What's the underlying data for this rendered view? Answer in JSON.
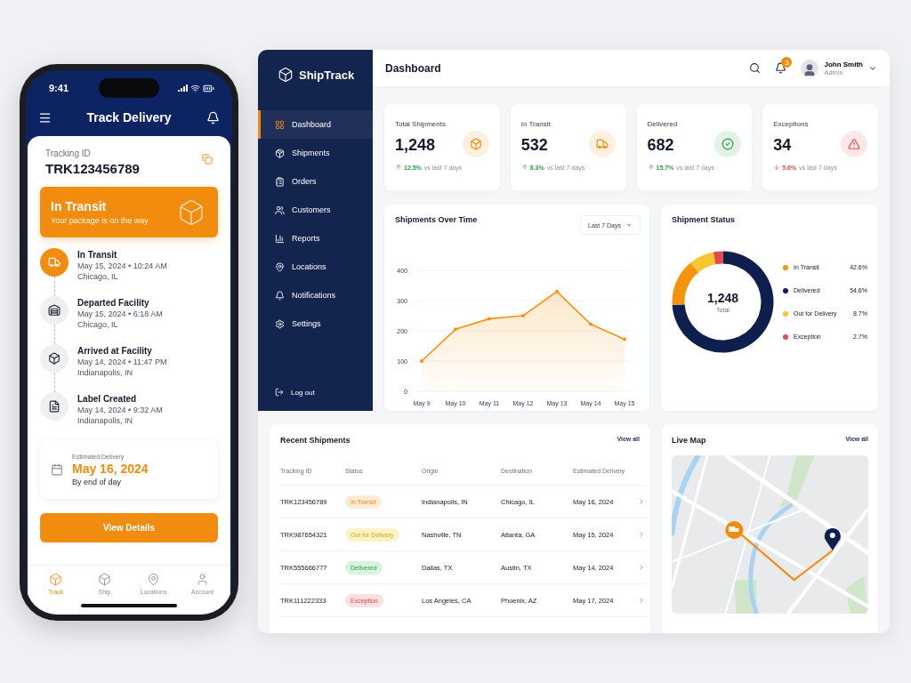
{
  "phone": {
    "status_bar": {
      "time": "9:41"
    },
    "header": {
      "title": "Track Delivery"
    },
    "tracking": {
      "label": "Tracking ID",
      "id": "TRK123456789"
    },
    "banner": {
      "title": "In Transit",
      "subtitle": "Your package is on the way"
    },
    "timeline": [
      {
        "title": "In Transit",
        "time": "May 15, 2024 • 10:24 AM",
        "place": "Chicago, IL",
        "active": true
      },
      {
        "title": "Departed Facility",
        "time": "May 15, 2024 • 6:18 AM",
        "place": "Chicago, IL",
        "active": false
      },
      {
        "title": "Arrived at Facility",
        "time": "May 14, 2024 • 11:47 PM",
        "place": "Indianapolis, IN",
        "active": false
      },
      {
        "title": "Label Created",
        "time": "May 14, 2024 • 9:32 AM",
        "place": "Indianapolis, IN",
        "active": false
      }
    ],
    "estimate": {
      "label": "Estimated Delivery",
      "date": "May 16, 2024",
      "note": "By end of day"
    },
    "button": "View Details",
    "nav": [
      {
        "label": "Track",
        "selected": true
      },
      {
        "label": "Ship",
        "selected": false
      },
      {
        "label": "Locations",
        "selected": false
      },
      {
        "label": "Account",
        "selected": false
      }
    ]
  },
  "dashboard": {
    "brand": "ShipTrack",
    "sidebar": {
      "items": [
        {
          "label": "Dashboard",
          "selected": true
        },
        {
          "label": "Shipments",
          "selected": false
        },
        {
          "label": "Orders",
          "selected": false
        },
        {
          "label": "Customers",
          "selected": false
        },
        {
          "label": "Reports",
          "selected": false
        },
        {
          "label": "Locations",
          "selected": false
        },
        {
          "label": "Notifications",
          "selected": false
        },
        {
          "label": "Settings",
          "selected": false
        }
      ],
      "logout": "Log out"
    },
    "header": {
      "title": "Dashboard",
      "notification_count": "3",
      "user": {
        "name": "John Smith",
        "role": "Admin"
      }
    },
    "stats": [
      {
        "title": "Total Shipments",
        "value": "1,248",
        "change": "12.5%",
        "period": "vs last 7 days",
        "trend_up": true
      },
      {
        "title": "In Transit",
        "value": "532",
        "change": "8.3%",
        "period": "vs last 7 days",
        "trend_up": true
      },
      {
        "title": "Delivered",
        "value": "682",
        "change": "15.7%",
        "period": "vs last 7 days",
        "trend_up": true
      },
      {
        "title": "Exceptions",
        "value": "34",
        "change": "5.6%",
        "period": "vs last 7 days",
        "trend_up": false
      }
    ],
    "line_chart": {
      "title": "Shipments Over Time",
      "range": "Last 7 Days",
      "chart_data": {
        "type": "area",
        "categories": [
          "May 9",
          "May 10",
          "May 11",
          "May 12",
          "May 13",
          "May 14",
          "May 15"
        ],
        "values": [
          100,
          205,
          240,
          250,
          330,
          222,
          172
        ],
        "ylim": [
          0,
          400
        ],
        "yticks": [
          0,
          100,
          200,
          300,
          400
        ],
        "grid": true
      }
    },
    "status_chart": {
      "title": "Shipment Status",
      "center_value": "1,248",
      "center_label": "Total",
      "legend": [
        {
          "label": "In Transit",
          "value": "42.6%",
          "color": "#f5930f"
        },
        {
          "label": "Delivered",
          "value": "54.6%",
          "color": "#0f1f4d"
        },
        {
          "label": "Out for Delivery",
          "value": "8.7%",
          "color": "#f7c631"
        },
        {
          "label": "Exception",
          "value": "2.7%",
          "color": "#e5484d"
        }
      ]
    },
    "recent": {
      "title": "Recent Shipments",
      "link": "View all",
      "columns": [
        "Tracking ID",
        "Status",
        "Origin",
        "Destination",
        "Estimated Delivery"
      ],
      "rows": [
        {
          "id": "TRK123456789",
          "status": "In Transit",
          "kind": "transit",
          "origin": "Indianapolis, IN",
          "destination": "Chicago, IL",
          "eta": "May 16, 2024"
        },
        {
          "id": "TRK987654321",
          "status": "Out for Delivery",
          "kind": "out",
          "origin": "Nashville, TN",
          "destination": "Atlanta, GA",
          "eta": "May 15, 2024"
        },
        {
          "id": "TRK555666777",
          "status": "Delivered",
          "kind": "delivered",
          "origin": "Dallas, TX",
          "destination": "Austin, TX",
          "eta": "May 14, 2024"
        },
        {
          "id": "TRK111222333",
          "status": "Exception",
          "kind": "exception",
          "origin": "Los Angeles, CA",
          "destination": "Phoenix, AZ",
          "eta": "May 17, 2024"
        }
      ]
    },
    "map": {
      "title": "Live Map",
      "link": "View all"
    }
  }
}
